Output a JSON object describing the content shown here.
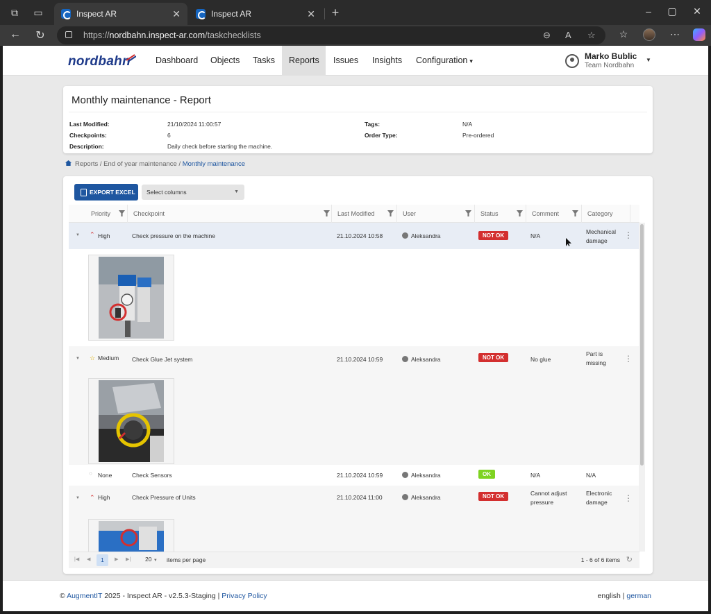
{
  "browser": {
    "tabs": [
      {
        "title": "Inspect AR",
        "active": true
      },
      {
        "title": "Inspect AR",
        "active": false
      }
    ],
    "url_prefix": "https://",
    "url_host": "nordbahn.inspect-ar.com",
    "url_path": "/taskchecklists"
  },
  "app": {
    "logo": "nordbahn",
    "nav": [
      "Dashboard",
      "Objects",
      "Tasks",
      "Reports",
      "Issues",
      "Insights",
      "Configuration"
    ],
    "active_nav": "Reports",
    "user_name": "Marko Bublic",
    "user_team": "Team Nordbahn"
  },
  "report": {
    "title": "Monthly maintenance - Report",
    "meta": {
      "last_modified_label": "Last Modified:",
      "last_modified": "21/10/2024 11:00:57",
      "checkpoints_label": "Checkpoints:",
      "checkpoints": "6",
      "description_label": "Description:",
      "description": "Daily check before starting the machine.",
      "tags_label": "Tags:",
      "tags": "N/A",
      "order_type_label": "Order Type:",
      "order_type": "Pre-ordered"
    }
  },
  "breadcrumb": {
    "path": "Reports / End of year maintenance /",
    "current": "Monthly maintenance"
  },
  "toolbar": {
    "export_label": "EXPORT EXCEL",
    "select_columns": "Select columns"
  },
  "grid": {
    "headers": [
      "Priority",
      "Checkpoint",
      "Last Modified",
      "User",
      "Status",
      "Comment",
      "Category"
    ],
    "rows": [
      {
        "priority": "High",
        "checkpoint": "Check pressure on the machine",
        "modified": "21.10.2024 10:58",
        "user": "Aleksandra",
        "status": "NOT OK",
        "comment": "N/A",
        "category": "Mechanical damage"
      },
      {
        "priority": "Medium",
        "checkpoint": "Check Glue Jet system",
        "modified": "21.10.2024 10:59",
        "user": "Aleksandra",
        "status": "NOT OK",
        "comment": "No glue",
        "category": "Part is missing"
      },
      {
        "priority": "None",
        "checkpoint": "Check Sensors",
        "modified": "21.10.2024 10:59",
        "user": "Aleksandra",
        "status": "OK",
        "comment": "N/A",
        "category": "N/A"
      },
      {
        "priority": "High",
        "checkpoint": "Check Pressure of Units",
        "modified": "21.10.2024 11:00",
        "user": "Aleksandra",
        "status": "NOT OK",
        "comment": "Cannot adjust pressure",
        "category": "Electronic damage"
      }
    ]
  },
  "pager": {
    "current_page": "1",
    "page_size": "20",
    "items_per_page": "items per page",
    "count": "1 - 6 of 6 items"
  },
  "footer": {
    "copyright": "©",
    "company": "AugmentIT",
    "version": "2025 - Inspect AR - v2.5.3-Staging",
    "sep": "|",
    "privacy": "Privacy Policy",
    "lang_en": "english",
    "lang_sep": "|",
    "lang_de": "german"
  },
  "colors": {
    "accent": "#1e56a0",
    "not_ok": "#d32f2f",
    "ok": "#7ed321",
    "high": "#d32f2f",
    "medium": "#e0b000"
  }
}
